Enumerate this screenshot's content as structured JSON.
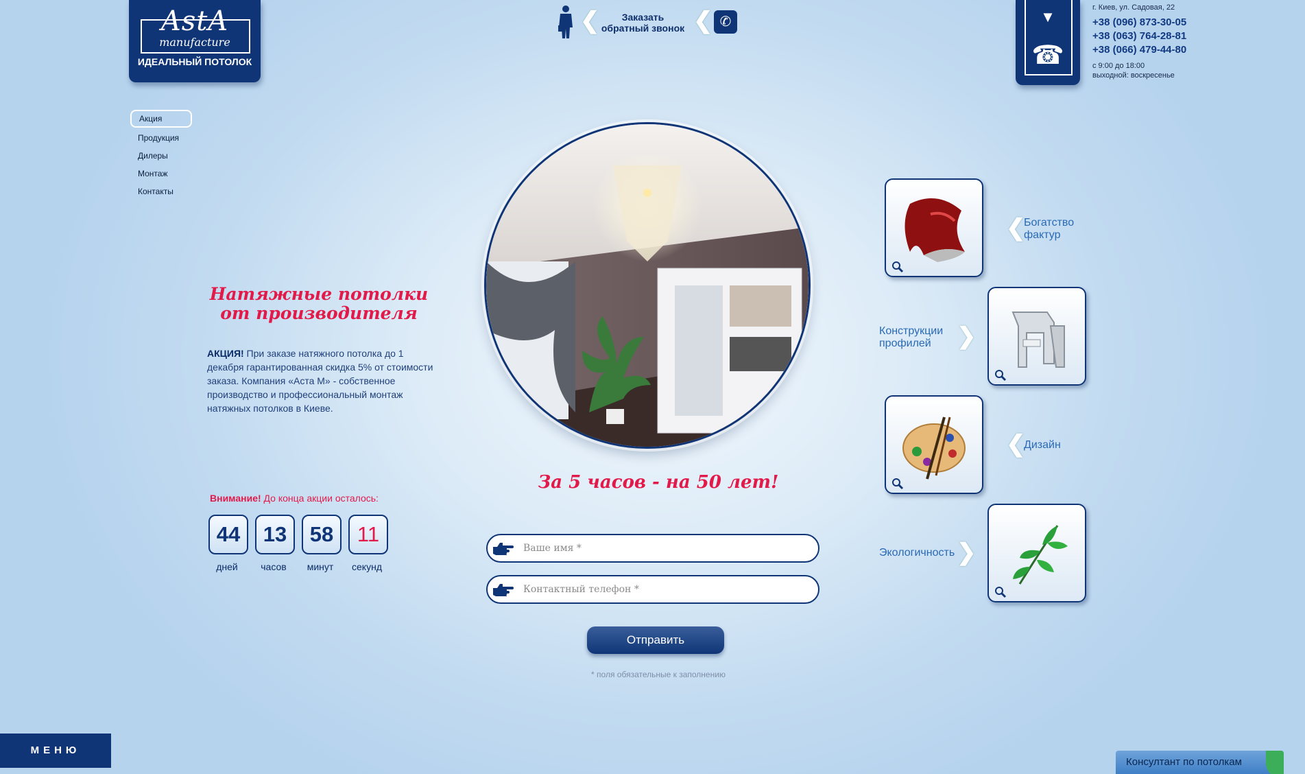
{
  "logo": {
    "brand": "AstA",
    "sub": "manufacture",
    "tagline": "ИДЕАЛЬНЫЙ ПОТОЛОК"
  },
  "callback": {
    "line1": "Заказать",
    "line2": "обратный звонок"
  },
  "contacts": {
    "address": "г. Киев, ул. Садовая, 22",
    "phones": [
      "+38 (096) 873-30-05",
      "+38 (063) 764-28-81",
      "+38 (066) 479-44-80"
    ],
    "hours": "с 9:00 до 18:00",
    "dayoff": "выходной: воскресенье"
  },
  "nav": {
    "items": [
      "Акция",
      "Продукция",
      "Дилеры",
      "Монтаж",
      "Контакты"
    ],
    "active": 0
  },
  "promo": {
    "title1": "Натяжные потолки",
    "title2": "от производителя",
    "lead": "АКЦИЯ!",
    "text": " При заказе натяжного потолка до 1 декабря гарантированная скидка 5% от стоимости заказа. Компания «Аста М» - собственное производство и профессиональный монтаж натяжных потолков в Киеве."
  },
  "countdown": {
    "warn_lead": "Внимание!",
    "warn_text": " До конца акции осталось:",
    "days": "44",
    "hours": "13",
    "minutes": "58",
    "seconds": "11",
    "days_label": "дней",
    "hours_label": "часов",
    "minutes_label": "минут",
    "seconds_label": "секунд"
  },
  "slogan": "За 5 часов - на 50 лет!",
  "form": {
    "name_placeholder": "Ваше имя *",
    "phone_placeholder": "Контактный телефон *",
    "submit": "Отправить",
    "required_note": "* поля обязательные к заполнению"
  },
  "features": [
    {
      "label1": "Богатство",
      "label2": "фактур",
      "icon": "fabric-icon"
    },
    {
      "label1": "Конструкции",
      "label2": "профилей",
      "icon": "profile-icon"
    },
    {
      "label1": "Дизайн",
      "label2": "",
      "icon": "palette-icon"
    },
    {
      "label1": "Экологичность",
      "label2": "",
      "icon": "leaf-icon"
    }
  ],
  "bottom": {
    "menu": "МЕНЮ",
    "consultant": "Консултант по потолкам"
  },
  "colors": {
    "navy": "#0f3577",
    "accent_red": "#e21a4a",
    "link_blue": "#2a6ab5"
  }
}
